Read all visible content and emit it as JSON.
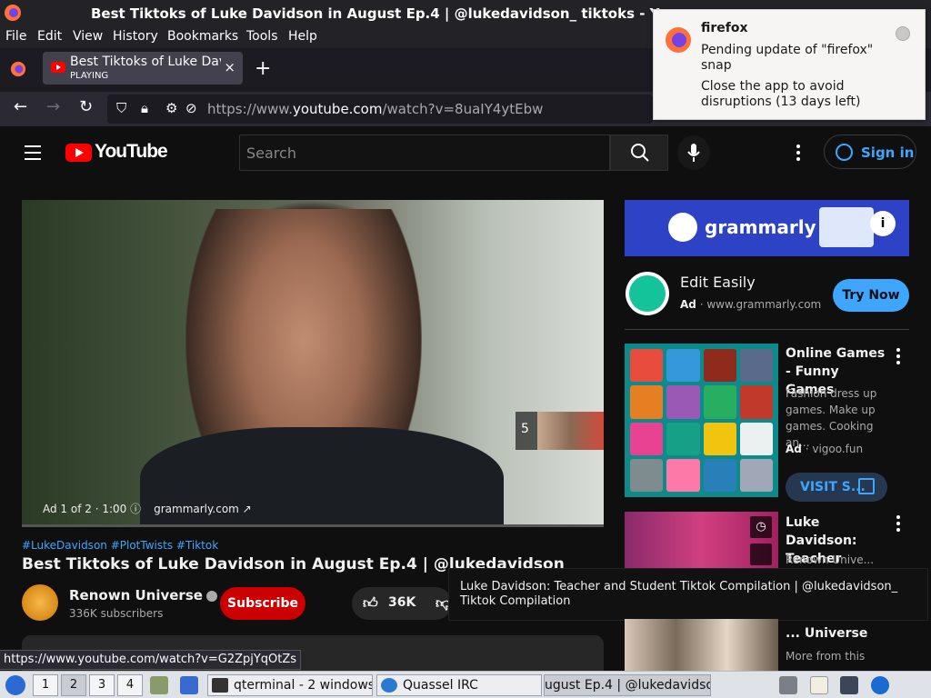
{
  "window": {
    "title": "Best Tiktoks of Luke Davidson in August Ep.4 | @lukedavidson_ tiktoks - Yo"
  },
  "menu": [
    "File",
    "Edit",
    "View",
    "History",
    "Bookmarks",
    "Tools",
    "Help"
  ],
  "tab": {
    "title": "Best Tiktoks of Luke Davidson",
    "status": "PLAYING",
    "close": "×",
    "new_tab": "+"
  },
  "navbar": {
    "url_prefix": "https://www.",
    "url_domain": "youtube.com",
    "url_path": "/watch?v=8uaIY4ytEbw"
  },
  "notification": {
    "app": "firefox",
    "line1": "Pending update of \"firefox\" snap",
    "line2": "Close the app to avoid disruptions (13 days left)"
  },
  "youtube": {
    "logo": "YouTube",
    "search_placeholder": "Search",
    "sign_in": "Sign in"
  },
  "player": {
    "ad_info": "Ad 1 of 2 · 1:00 ⓘ",
    "ad_domain": "grammarly.com ↗",
    "skip_count": "5",
    "progress_fraction": 0.0
  },
  "video": {
    "hashtags": "#LukeDavidson #PlotTwists #Tiktok",
    "title": "Best Tiktoks of Luke Davidson in August Ep.4 | @lukedavidson_ tiktoks",
    "channel": "Renown Universe",
    "subscribers": "336K subscribers",
    "subscribe": "Subscribe",
    "likes": "36K"
  },
  "tooltip": {
    "text": "Luke Davidson: Teacher and Student Tiktok Compilation | @lukedavidson_ Tiktok Compilation"
  },
  "sidebar": {
    "banner_text": "grammarly",
    "ad_title": "Edit Easily",
    "ad_label": "Ad",
    "ad_domain": "www.grammarly.com",
    "ad_cta": "Try Now",
    "game_title": "Online Games - Funny Games",
    "game_desc": "Fashion dress up games. Make up games. Cooking an...",
    "game_ad_label": "Ad",
    "game_domain": "vigoo.fun",
    "game_cta": "VISIT S...",
    "rec1_title": "Luke Davidson: Teacher and...",
    "rec1_channel": "Renown Unive...",
    "rec2_title": "... Universe",
    "rec2_sub": "More from this"
  },
  "status_url": "https://www.youtube.com/watch?v=G2ZpjYqOtZs",
  "taskbar": {
    "workspaces": [
      "1",
      "2",
      "3",
      "4"
    ],
    "apps": [
      "qterminal - 2 windows",
      "Quassel IRC",
      "ugust Ep.4 | @lukedavidson"
    ]
  }
}
